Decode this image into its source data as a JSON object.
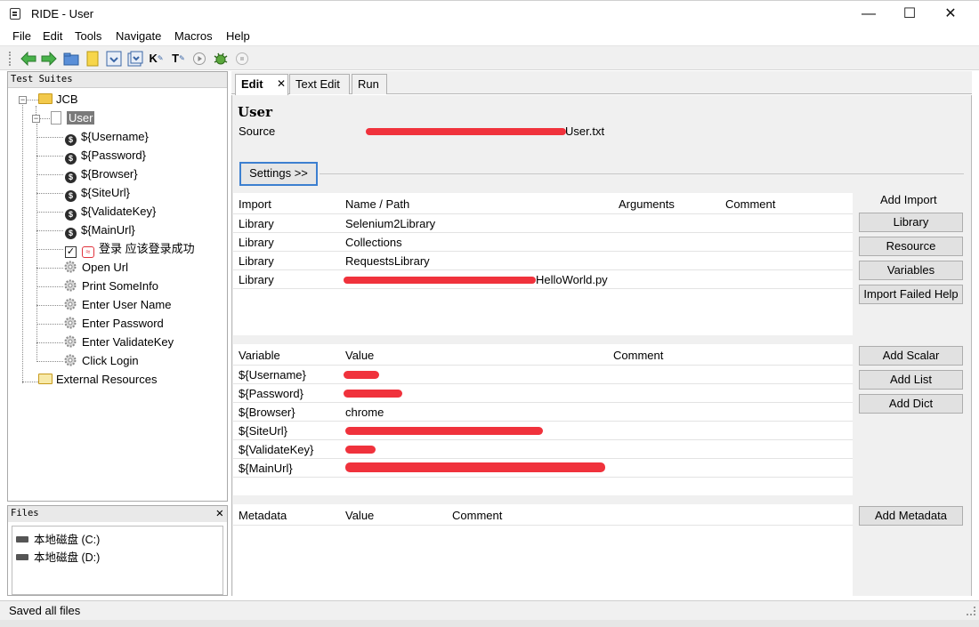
{
  "window": {
    "title": "RIDE - User",
    "minimize": "—",
    "maximize": "☐",
    "close": "✕"
  },
  "menubar": [
    "File",
    "Edit",
    "Tools",
    "Navigate",
    "Macros",
    "Help"
  ],
  "toolbar_icons": [
    "back-icon",
    "forward-icon",
    "open-folder-icon",
    "new-file-icon",
    "save-icon",
    "save-all-icon",
    "keyword-search-icon",
    "test-search-icon",
    "run-icon",
    "debug-icon",
    "stop-icon"
  ],
  "tree": {
    "header": "Test Suites",
    "root": "JCB",
    "suite": "User",
    "variables": [
      "${Username}",
      "${Password}",
      "${Browser}",
      "${SiteUrl}",
      "${ValidateKey}",
      "${MainUrl}"
    ],
    "test_case": "登录 应该登录成功",
    "keywords": [
      "Open Url",
      "Print SomeInfo",
      "Enter User Name",
      "Enter Password",
      "Enter ValidateKey",
      "Click Login"
    ],
    "external": "External Resources"
  },
  "files": {
    "header": "Files",
    "close": "✕",
    "drives": [
      "本地磁盘 (C:)",
      "本地磁盘 (D:)"
    ]
  },
  "tabs": [
    "Edit",
    "Text Edit",
    "Run"
  ],
  "tab_close": "✕",
  "editor": {
    "name": "User",
    "source_label": "Source",
    "source_value": "User.txt",
    "settings_button": "Settings >>",
    "imports": {
      "headers": [
        "Import",
        "Name / Path",
        "Arguments",
        "Comment"
      ],
      "rows": [
        [
          "Library",
          "Selenium2Library"
        ],
        [
          "Library",
          "Collections"
        ],
        [
          "Library",
          "RequestsLibrary"
        ],
        [
          "Library",
          "HelloWorld.py"
        ]
      ]
    },
    "import_side": {
      "title": "Add Import",
      "buttons": [
        "Library",
        "Resource",
        "Variables",
        "Import Failed Help"
      ]
    },
    "variables": {
      "headers": [
        "Variable",
        "Value",
        "Comment"
      ],
      "rows": [
        [
          "${Username}",
          ""
        ],
        [
          "${Password}",
          ""
        ],
        [
          "${Browser}",
          "chrome"
        ],
        [
          "${SiteUrl}",
          ""
        ],
        [
          "${ValidateKey}",
          ""
        ],
        [
          "${MainUrl}",
          ""
        ]
      ]
    },
    "variable_buttons": [
      "Add Scalar",
      "Add List",
      "Add Dict"
    ],
    "metadata": {
      "headers": [
        "Metadata",
        "Value",
        "Comment"
      ]
    },
    "metadata_button": "Add Metadata"
  },
  "status": "Saved all files",
  "colors": {
    "redaction": "#f0323c",
    "selection": "#7a7a7a",
    "settings_border": "#3c7fd0"
  }
}
